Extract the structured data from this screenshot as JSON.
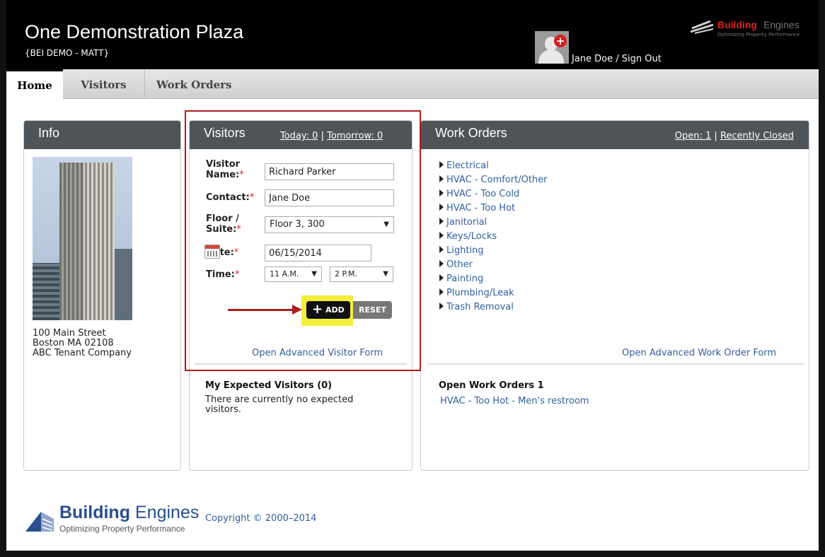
{
  "header": {
    "title": "One Demonstration Plaza",
    "subtitle": "{BEI DEMO - MATT}",
    "user_name": "Jane Doe",
    "separator": " / ",
    "sign_out": "Sign Out",
    "avatar_badge": "+",
    "brand_bold": "Building",
    "brand_light": "Engines",
    "brand_tagline": "Optimizing Property Performance"
  },
  "nav": {
    "tabs": [
      {
        "label": "Home",
        "active": true
      },
      {
        "label": "Visitors",
        "active": false
      },
      {
        "label": "Work Orders",
        "active": false
      }
    ]
  },
  "info": {
    "title": "Info",
    "address_line1": "100 Main Street",
    "address_line2": "Boston MA 02108",
    "company": "ABC Tenant Company"
  },
  "visitors": {
    "title": "Visitors",
    "today_label": "Today: 0",
    "separator": " | ",
    "tomorrow_label": "Tomorrow: 0",
    "form": {
      "visitor_name_label_1": "Visitor",
      "visitor_name_label_2": "Name:",
      "visitor_name_value": "Richard Parker",
      "contact_label": "Contact:",
      "contact_value": "Jane Doe",
      "floor_label_1": "Floor /",
      "floor_label_2": "Suite:",
      "floor_value": "Floor 3, 300",
      "date_label": "Date:",
      "date_value": "06/15/2014",
      "time_label": "Time:",
      "time_from": "11 A.M.",
      "time_to": "2 P.M.",
      "required_mark": "*",
      "select_arrow": "▼"
    },
    "add_label": "ADD",
    "add_icon": "+",
    "reset_label": "RESET",
    "advanced_link": "Open Advanced Visitor Form",
    "expected_title": "My Expected Visitors (0)",
    "expected_empty_1": "There are currently no expected",
    "expected_empty_2": "visitors."
  },
  "work_orders": {
    "title": "Work Orders",
    "open_label": "Open: 1",
    "separator": " | ",
    "recently_closed_label": "Recently Closed",
    "categories": [
      "Electrical",
      "HVAC - Comfort/Other",
      "HVAC - Too Cold",
      "HVAC - Too Hot",
      "Janitorial",
      "Keys/Locks",
      "Lighting",
      "Other",
      "Painting",
      "Plumbing/Leak",
      "Trash Removal"
    ],
    "advanced_link": "Open Advanced Work Order Form",
    "open_title": "Open Work Orders 1",
    "open_item": "HVAC - Too Hot - Men's restroom"
  },
  "footer": {
    "brand_bold": "Building",
    "brand_light": "Engines",
    "tagline": "Optimizing Property Performance",
    "copyright": "Copyright © 2000–2014"
  },
  "colors": {
    "header_bg": "#000000",
    "panel_header_bg": "#4f5459",
    "link": "#2f5f9f",
    "brand_red": "#e02020",
    "brand_blue": "#2a4f8c",
    "highlight_yellow": "#f4ef3c",
    "annotation_red": "#b01c1c"
  },
  "icons": [
    "user-avatar-icon",
    "add-plus-icon",
    "calendar-icon",
    "triangle-right-icon",
    "select-arrow-icon"
  ]
}
